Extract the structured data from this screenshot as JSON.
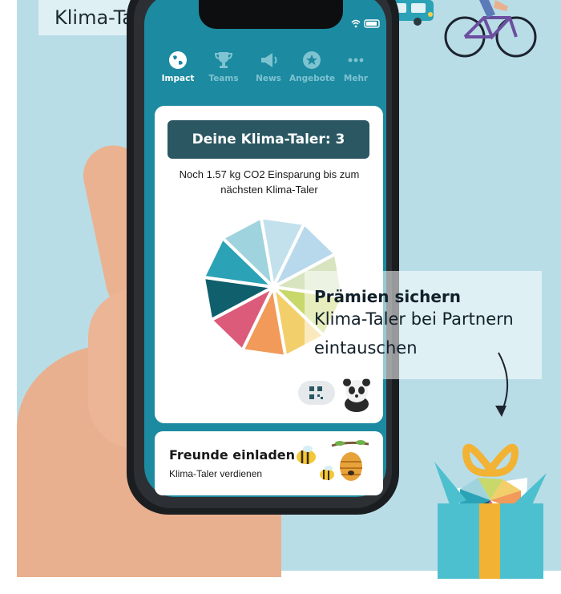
{
  "header": {
    "title": "Klima-Taler sammeln"
  },
  "status_bar": {
    "icons": "wifi battery"
  },
  "tabs": [
    {
      "label": "Impact",
      "icon": "globe-icon",
      "active": true
    },
    {
      "label": "Teams",
      "icon": "trophy-icon",
      "active": false
    },
    {
      "label": "News",
      "icon": "megaphone-icon",
      "active": false
    },
    {
      "label": "Angebote",
      "icon": "star-icon",
      "active": false
    },
    {
      "label": "Mehr",
      "icon": "more-dots-icon",
      "active": false
    }
  ],
  "main": {
    "taler_label": "Deine Klima-Taler: 3",
    "savings_line1": "Noch 1.57 kg CO2 Einsparung bis zum",
    "savings_line2": "nächsten Klima-Taler",
    "progress_slices": [
      {
        "color": "#c3e1ec",
        "filled": true
      },
      {
        "color": "#b8d8ec",
        "filled": true
      },
      {
        "color": "#d8e4c0",
        "filled": true
      },
      {
        "color": "#c9d86a",
        "filled": true
      },
      {
        "color": "#f3cf6b",
        "filled": true
      },
      {
        "color": "#f19a5a",
        "filled": true
      },
      {
        "color": "#dc5b7a",
        "filled": true
      },
      {
        "color": "#0f5f6d",
        "filled": true
      },
      {
        "color": "#2ba2b6",
        "filled": true
      },
      {
        "color": "#9fd3dd",
        "filled": true
      }
    ]
  },
  "invite": {
    "title": "Freunde einladen",
    "subtitle": "Klima-Taler verdienen"
  },
  "promo": {
    "title": "Prämien sichern",
    "line1": "Klima-Taler bei Partnern",
    "line2": "eintauschen"
  },
  "colors": {
    "background": "#b9dde6",
    "tabbar": "#1c8aa0",
    "taler_box": "#2a5762",
    "gift_box": "#4cc0cf",
    "gift_ribbon": "#f2b233"
  }
}
